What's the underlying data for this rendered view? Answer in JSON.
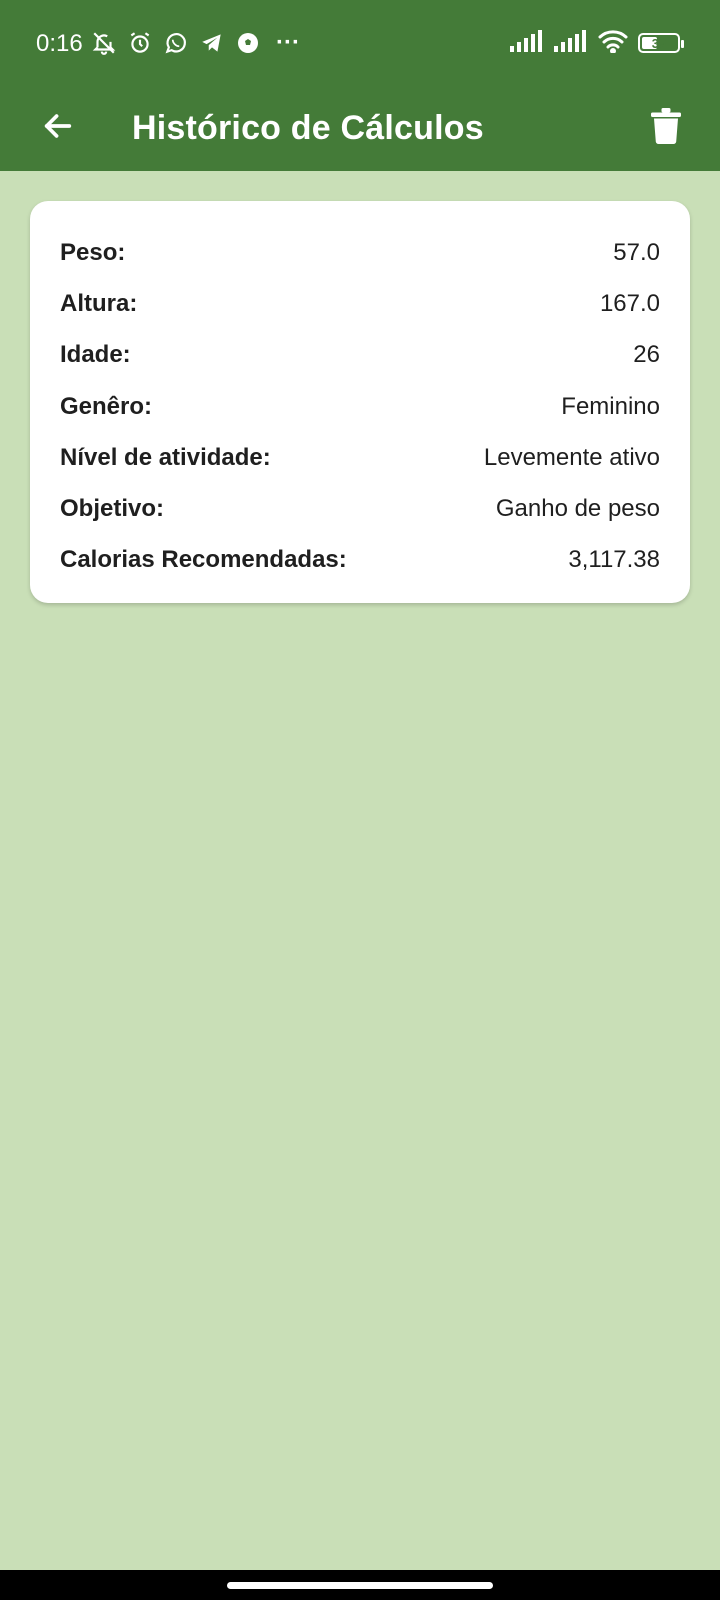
{
  "status_bar": {
    "time": "0:16",
    "left_icons": [
      "muted-bell-icon",
      "alarm-icon",
      "whatsapp-icon",
      "telegram-icon",
      "soccer-ball-icon",
      "more-dots-icon"
    ],
    "more_dots": "···",
    "right_icons": [
      "signal-icon",
      "signal-icon",
      "wifi-icon",
      "battery-icon"
    ],
    "battery_level": "39"
  },
  "app_bar": {
    "title": "Histórico de Cálculos",
    "back_icon": "arrow-back-icon",
    "delete_icon": "trash-icon",
    "background_color": "#447b38"
  },
  "history": {
    "card": {
      "rows": [
        {
          "label": "Peso:",
          "value": "57.0"
        },
        {
          "label": "Altura:",
          "value": "167.0"
        },
        {
          "label": "Idade:",
          "value": "26"
        },
        {
          "label": "Genêro:",
          "value": "Feminino"
        },
        {
          "label": "Nível de atividade:",
          "value": "Levemente ativo"
        },
        {
          "label": "Objetivo:",
          "value": "Ganho de peso"
        },
        {
          "label": "Calorias Recomendadas:",
          "value": "3,117.38"
        }
      ]
    }
  },
  "colors": {
    "primary": "#447b38",
    "background": "#c9dfb7",
    "card": "#ffffff"
  }
}
